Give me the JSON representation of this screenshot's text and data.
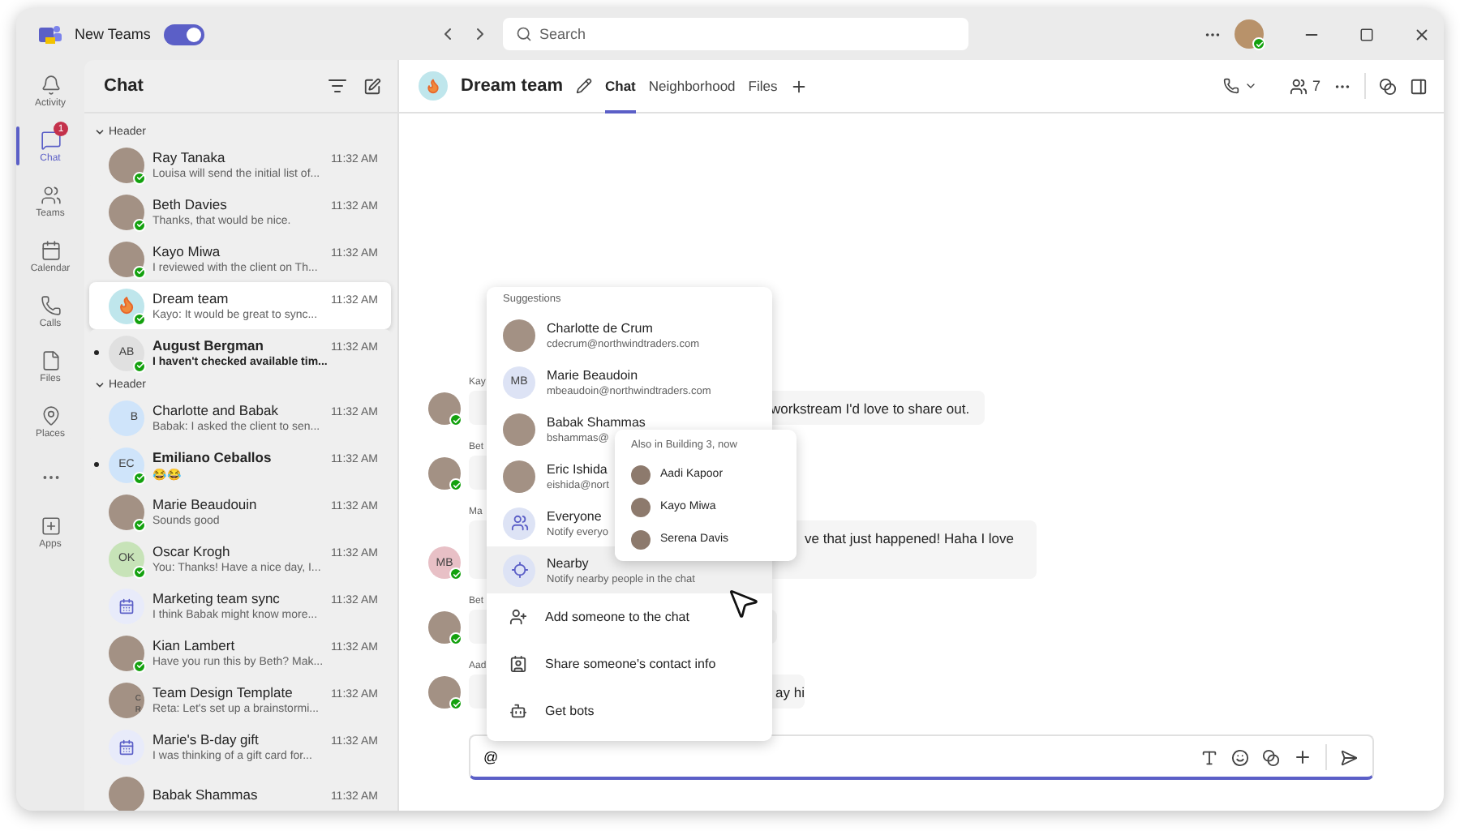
{
  "title_bar": {
    "app_name": "New Teams",
    "toggle": {
      "on": true
    },
    "search": {
      "placeholder": "Search"
    }
  },
  "rail": [
    {
      "kind": "activity",
      "label": "Activity",
      "selected": false
    },
    {
      "kind": "chat",
      "label": "Chat",
      "selected": true,
      "badge": "1"
    },
    {
      "kind": "teams",
      "label": "Teams",
      "selected": false
    },
    {
      "kind": "calendar",
      "label": "Calendar",
      "selected": false
    },
    {
      "kind": "calls",
      "label": "Calls",
      "selected": false
    },
    {
      "kind": "files",
      "label": "Files",
      "selected": false
    },
    {
      "kind": "places",
      "label": "Places",
      "selected": false
    },
    {
      "kind": "more",
      "selected": false
    },
    {
      "kind": "apps",
      "label": "Apps",
      "selected": false
    }
  ],
  "chat_list": {
    "title": "Chat",
    "sections": [
      {
        "header": "Header",
        "expanded": true,
        "items": [
          {
            "kind": "photo",
            "name": "Ray Tanaka",
            "time": "11:32 AM",
            "preview": "Louisa will send the initial list of...",
            "online": true,
            "unread": false,
            "selected": false
          },
          {
            "kind": "photo",
            "name": "Beth Davies",
            "time": "11:32 AM",
            "preview": "Thanks, that would be nice.",
            "online": true,
            "unread": false,
            "selected": false
          },
          {
            "kind": "photo",
            "name": "Kayo Miwa",
            "time": "11:32 AM",
            "preview": "I reviewed with the client on Th...",
            "online": true,
            "unread": false,
            "selected": false
          },
          {
            "kind": "team",
            "name": "Dream team",
            "time": "11:32 AM",
            "preview": "Kayo: It would be great to sync...",
            "online": true,
            "unread": false,
            "selected": true
          },
          {
            "kind": "initials",
            "initials": "AB",
            "color": "#e0e0e0",
            "name": "August Bergman",
            "time": "11:32 AM",
            "preview": "I haven't checked available tim...",
            "online": true,
            "unread": true,
            "selected": false
          }
        ]
      },
      {
        "header": "Header",
        "expanded": true,
        "items": [
          {
            "kind": "pair",
            "initials": "B",
            "color": "#cfe4fa",
            "name": "Charlotte and Babak",
            "time": "11:32 AM",
            "preview": "Babak: I asked the client to sen...",
            "online": false,
            "unread": false,
            "selected": false
          },
          {
            "kind": "initials",
            "initials": "EC",
            "color": "#cfe4fa",
            "name": "Emiliano Ceballos",
            "time": "11:32 AM",
            "preview": "😂😂",
            "online": true,
            "unread": true,
            "selected": false
          },
          {
            "kind": "photo",
            "name": "Marie Beaudouin",
            "time": "11:32 AM",
            "preview": "Sounds good",
            "online": true,
            "unread": false,
            "selected": false
          },
          {
            "kind": "initials",
            "initials": "OK",
            "color": "#c7e3b8",
            "name": "Oscar Krogh",
            "time": "11:32 AM",
            "preview": "You: Thanks! Have a nice day, I...",
            "online": true,
            "unread": false,
            "selected": false
          },
          {
            "kind": "meeting",
            "name": "Marketing team sync",
            "time": "11:32 AM",
            "preview": "I think Babak might know more...",
            "online": false,
            "unread": false,
            "selected": false
          },
          {
            "kind": "photo",
            "name": "Kian Lambert",
            "time": "11:32 AM",
            "preview": "Have you run this by Beth? Mak...",
            "online": true,
            "unread": false,
            "selected": false
          },
          {
            "kind": "group",
            "letters": [
              "C",
              "R"
            ],
            "name": "Team Design Template",
            "time": "11:32 AM",
            "preview": "Reta: Let's set up a brainstormi...",
            "online": false,
            "unread": false,
            "selected": false
          },
          {
            "kind": "meeting",
            "name": "Marie's B-day gift",
            "time": "11:32 AM",
            "preview": "I was thinking of a gift card for...",
            "online": false,
            "unread": false,
            "selected": false
          },
          {
            "kind": "photo",
            "name": "Babak Shammas",
            "time": "11:32 AM",
            "online": false,
            "unread": false,
            "selected": false
          }
        ]
      }
    ]
  },
  "conversation": {
    "title": "Dream team",
    "tabs": [
      {
        "label": "Chat",
        "selected": true
      },
      {
        "label": "Neighborhood",
        "selected": false
      },
      {
        "label": "Files",
        "selected": false
      }
    ],
    "participants": "7",
    "messages": [
      {
        "kind": "photo",
        "sender": "Kay",
        "text": "workstream I'd love to share out.",
        "online": true
      },
      {
        "kind": "photo",
        "sender": "Bet",
        "online": true
      },
      {
        "kind": "initials",
        "initials": "MB",
        "color": "#e8c0c6",
        "sender": "Ma",
        "text": "ve that just happened! Haha I love",
        "online": true
      },
      {
        "kind": "photo",
        "sender": "Bet",
        "online": true
      },
      {
        "kind": "photo",
        "sender": "Aad",
        "text": "ay hi",
        "online": true
      }
    ],
    "compose": {
      "value": "@"
    }
  },
  "mention_popup": {
    "header": "Suggestions",
    "items": [
      {
        "kind": "photo_person",
        "name": "Charlotte de Crum",
        "detail": "cdecrum@northwindtraders.com",
        "selected": false
      },
      {
        "kind": "initials_person",
        "initials": "MB",
        "color": "#dde3f5",
        "name": "Marie Beaudoin",
        "detail": "mbeaudoin@northwindtraders.com",
        "selected": false
      },
      {
        "kind": "photo_person",
        "name": "Babak Shammas",
        "detail": "bshammas@",
        "selected": false
      },
      {
        "kind": "photo_person",
        "name": "Eric Ishida",
        "detail": "eishida@nort",
        "selected": false
      },
      {
        "kind": "everyone",
        "name": "Everyone",
        "detail": "Notify everyo",
        "selected": false
      },
      {
        "kind": "nearby",
        "name": "Nearby",
        "detail": "Notify nearby people in the chat",
        "selected": true
      },
      {
        "kind": "add",
        "name": "Add someone to the chat",
        "selected": false
      },
      {
        "kind": "share",
        "name": "Share someone's contact info",
        "selected": false
      },
      {
        "kind": "bots",
        "name": "Get bots",
        "selected": false
      }
    ]
  },
  "nearby_popup": {
    "header": "Also in Building 3, now",
    "people": [
      "Aadi Kapoor",
      "Kayo Miwa",
      "Serena Davis"
    ]
  }
}
